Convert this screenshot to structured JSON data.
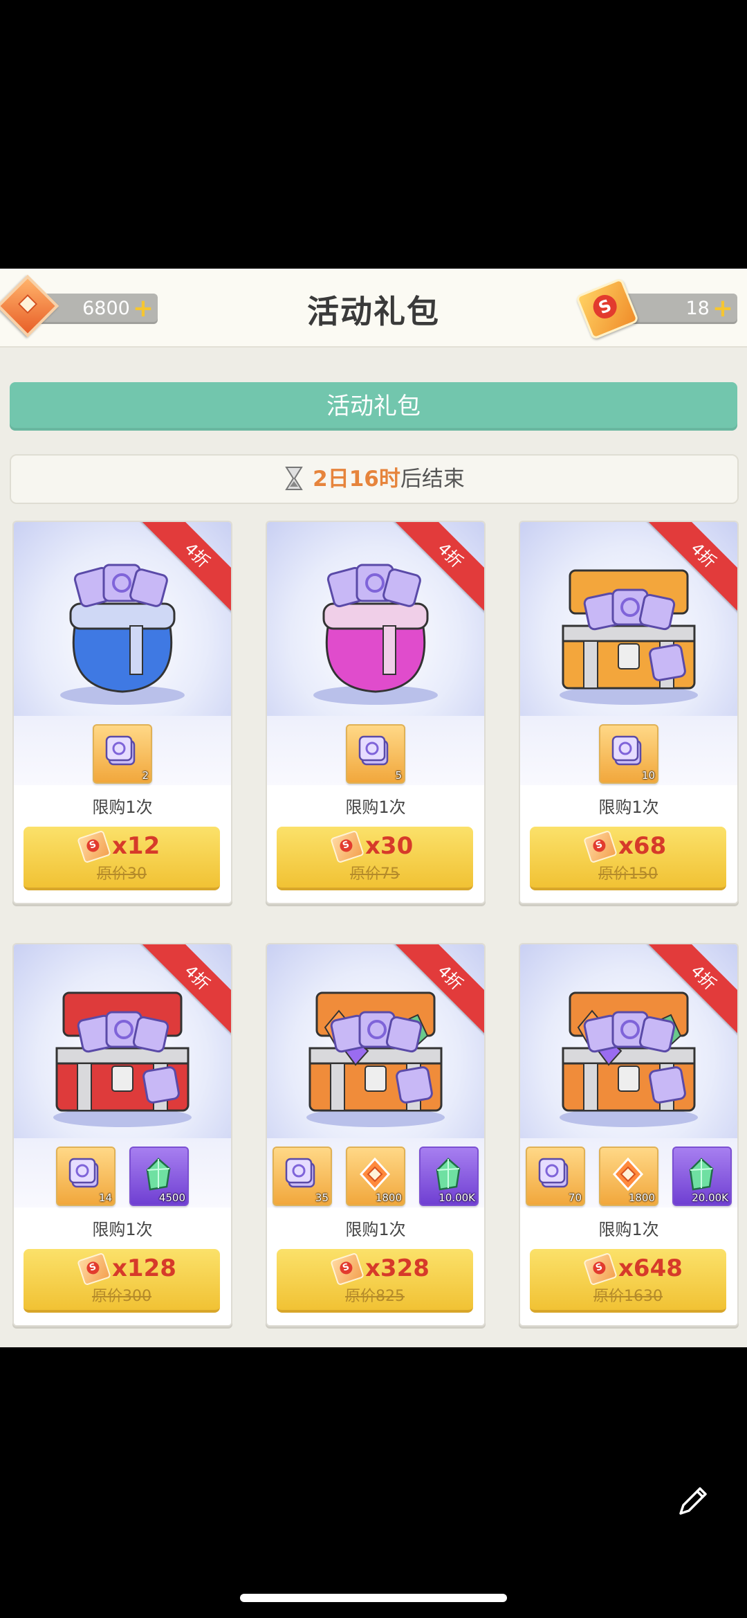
{
  "header": {
    "title": "活动礼包",
    "diamond_amount": "6800",
    "ticket_amount": "18",
    "plus_symbol": "+"
  },
  "tab": {
    "label": "活动礼包"
  },
  "timer": {
    "remaining": "2日16时",
    "suffix": "后结束"
  },
  "packs": [
    {
      "discount": "4折",
      "art": "blue-pouch",
      "items": [
        {
          "type": "ticket",
          "count": "2"
        }
      ],
      "limit": "限购1次",
      "price": "x12",
      "original": "原价30"
    },
    {
      "discount": "4折",
      "art": "pink-pouch",
      "items": [
        {
          "type": "ticket",
          "count": "5"
        }
      ],
      "limit": "限购1次",
      "price": "x30",
      "original": "原价75"
    },
    {
      "discount": "4折",
      "art": "gold-chest",
      "items": [
        {
          "type": "ticket",
          "count": "10"
        }
      ],
      "limit": "限购1次",
      "price": "x68",
      "original": "原价150"
    },
    {
      "discount": "4折",
      "art": "red-chest",
      "items": [
        {
          "type": "ticket",
          "count": "14"
        },
        {
          "type": "crystal",
          "count": "4500"
        }
      ],
      "limit": "限购1次",
      "price": "x128",
      "original": "原价300"
    },
    {
      "discount": "4折",
      "art": "gem-chest",
      "items": [
        {
          "type": "ticket",
          "count": "35"
        },
        {
          "type": "diamond",
          "count": "1800"
        },
        {
          "type": "crystal",
          "count": "10.00K"
        }
      ],
      "limit": "限购1次",
      "price": "x328",
      "original": "原价825"
    },
    {
      "discount": "4折",
      "art": "gem-chest-large",
      "items": [
        {
          "type": "ticket",
          "count": "70"
        },
        {
          "type": "diamond",
          "count": "1800"
        },
        {
          "type": "crystal",
          "count": "20.00K"
        }
      ],
      "limit": "限购1次",
      "price": "x648",
      "original": "原价1630"
    }
  ],
  "colors": {
    "accent_tab": "#72c6ad",
    "ribbon": "#e23b3b",
    "buy_button": "#f1c234",
    "price_text": "#d63a2a",
    "timer_highlight": "#e6843c"
  }
}
